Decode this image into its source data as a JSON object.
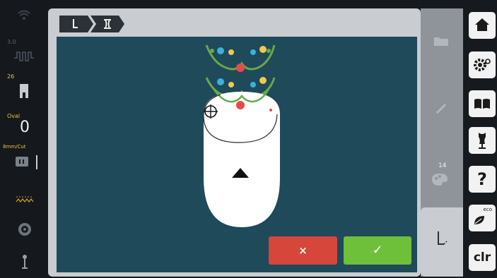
{
  "status": {
    "values": [
      "3.0",
      "26"
    ],
    "hoop_label": "Oval",
    "hoop_size": "0",
    "needle_label": "8mm/Cut"
  },
  "breadcrumb": {
    "step1_icon": "needle-icon",
    "step2_icon": "hoop-icon"
  },
  "tools": {
    "colors_count": "14"
  },
  "menu": {
    "home_icon": "home-icon",
    "settings_icon": "settings-icon",
    "guide_icon": "book-icon",
    "dressform_icon": "dressform-icon",
    "help_label": "?",
    "eco_label": "eco",
    "clr_label": "clr"
  },
  "actions": {
    "cancel_label": "×",
    "confirm_label": "✓"
  },
  "colors": {
    "canvas": "#1e4a5a",
    "cancel": "#d6463a",
    "confirm": "#6ebf3a",
    "accent_yellow": "#e9c53b"
  }
}
